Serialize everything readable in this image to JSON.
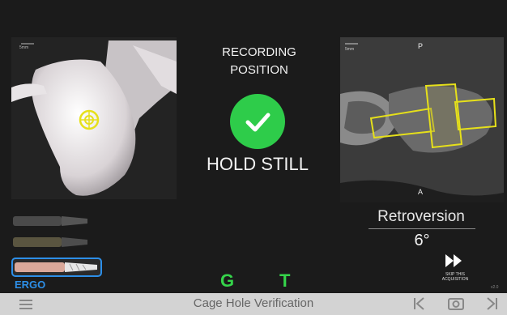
{
  "status": {
    "title_line1": "RECORDING",
    "title_line2": "POSITION",
    "instruction": "HOLD STILL"
  },
  "ct_view": {
    "top_label": "P",
    "bottom_label": "A",
    "scale_label": "5mm"
  },
  "bone_view": {
    "scale_label": "5mm"
  },
  "measurement": {
    "label": "Retroversion",
    "value": "6°"
  },
  "tools": {
    "selected_label": "ERGO"
  },
  "indicators": {
    "g": "G",
    "t": "T"
  },
  "skip": {
    "label_line1": "SKIP THIS",
    "label_line2": "ACQUISITION"
  },
  "version": "v2.0",
  "bottom_bar": {
    "title": "Cage Hole Verification"
  },
  "colors": {
    "accent_green": "#2ecc4a",
    "ergo_blue": "#2d8fe8",
    "outline_yellow": "#e6e01a"
  }
}
